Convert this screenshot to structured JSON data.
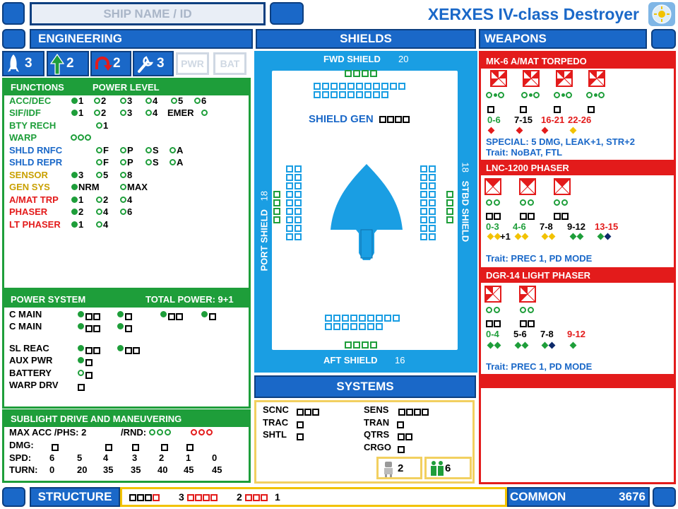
{
  "header": {
    "ship_name_placeholder": "SHIP NAME / ID",
    "title": "XERXES IV-class Destroyer"
  },
  "sections": {
    "engineering": "ENGINEERING",
    "shields": "SHIELDS",
    "weapons": "WEAPONS",
    "systems": "SYSTEMS",
    "structure": "STRUCTURE",
    "common": "COMMON",
    "common_value": "3676"
  },
  "eng_icons": [
    {
      "icon": "rocket-icon",
      "value": "3"
    },
    {
      "icon": "up-arrow-icon",
      "value": "2"
    },
    {
      "icon": "u-turn-icon",
      "value": "2"
    },
    {
      "icon": "wrench-icon",
      "value": "3"
    },
    {
      "icon": "pwr-button",
      "value": "PWR"
    },
    {
      "icon": "bat-button",
      "value": "BAT"
    }
  ],
  "functions": {
    "header_left": "FUNCTIONS",
    "header_right": "POWER LEVEL",
    "rows": [
      {
        "label": "ACC/DEC",
        "color": "g"
      },
      {
        "label": "SIF/IDF",
        "color": "g"
      },
      {
        "label": "BTY RECH",
        "color": "g"
      },
      {
        "label": "WARP",
        "color": "g"
      },
      {
        "label": "SHLD RNFC",
        "color": "b"
      },
      {
        "label": "SHLD REPR",
        "color": "b"
      },
      {
        "label": "SENSOR",
        "color": "o"
      },
      {
        "label": "GEN SYS",
        "color": "o"
      },
      {
        "label": "A/MAT TRP",
        "color": "r"
      },
      {
        "label": "PHASER",
        "color": "r"
      },
      {
        "label": "LT PHASER",
        "color": "r"
      }
    ],
    "vals": {
      "acc": [
        "1",
        "2",
        "3",
        "4",
        "5",
        "6"
      ],
      "sif": [
        "1",
        "2",
        "3",
        "4"
      ],
      "sif_emer": "EMER",
      "bty": "1",
      "shld": [
        "F",
        "P",
        "S",
        "A"
      ],
      "sensor": [
        "3",
        "5",
        "8"
      ],
      "gen": [
        "NRM",
        "MAX"
      ],
      "amat": [
        "1",
        "2",
        "4"
      ],
      "phaser": [
        "2",
        "4",
        "6"
      ],
      "lt": [
        "1",
        "4"
      ]
    }
  },
  "power": {
    "header_left": "POWER SYSTEM",
    "header_right": "TOTAL POWER: 9+1",
    "rows": [
      "C MAIN",
      "C MAIN",
      "SL REAC",
      "AUX PWR",
      "BATTERY",
      "WARP DRV"
    ]
  },
  "sublight": {
    "header": "SUBLIGHT DRIVE AND MANEUVERING",
    "max_acc": "MAX ACC /PHS: 2",
    "rnd": "/RND:",
    "dmg": "DMG:",
    "spd_label": "SPD:",
    "turn_label": "TURN:",
    "spd": [
      "6",
      "5",
      "4",
      "3",
      "2",
      "1",
      "0"
    ],
    "turn": [
      "0",
      "20",
      "35",
      "35",
      "40",
      "45",
      "45"
    ]
  },
  "shields": {
    "fwd": "FWD SHIELD",
    "fwd_val": "20",
    "aft": "AFT SHIELD",
    "aft_val": "16",
    "port": "PORT SHIELD",
    "port_val": "18",
    "stbd": "STBD SHIELD",
    "stbd_val": "18",
    "gen": "SHIELD GEN"
  },
  "systems": {
    "left": [
      "SCNC",
      "TRAC",
      "SHTL"
    ],
    "right": [
      "SENS",
      "TRAN",
      "QTRS",
      "CRGO"
    ],
    "crew_a": "2",
    "crew_b": "6"
  },
  "structure": {
    "g1": "3",
    "g2": "2",
    "g3": "1"
  },
  "weapons": [
    {
      "name": "MK-6   A/MAT TORPEDO",
      "ranges": [
        "0-6",
        "7-15",
        "16-21",
        "22-26"
      ],
      "special": "SPECIAL: 5 DMG, LEAK+1, STR+2",
      "trait": "Trait: NoBAT, FTL"
    },
    {
      "name": "LNC-1200 PHASER",
      "ranges": [
        "0-3",
        "4-6",
        "7-8",
        "9-12",
        "13-15"
      ],
      "plus": "+1",
      "trait": "Trait: PREC 1, PD MODE"
    },
    {
      "name": "DGR-14 LIGHT PHASER",
      "ranges": [
        "0-4",
        "5-6",
        "7-8",
        "9-12"
      ],
      "trait": "Trait: PREC 1, PD MODE"
    }
  ],
  "colors": {
    "blue": "#1a68c8",
    "green": "#1e9e3a",
    "red": "#e31b1b",
    "cyan": "#1a9ee3"
  }
}
